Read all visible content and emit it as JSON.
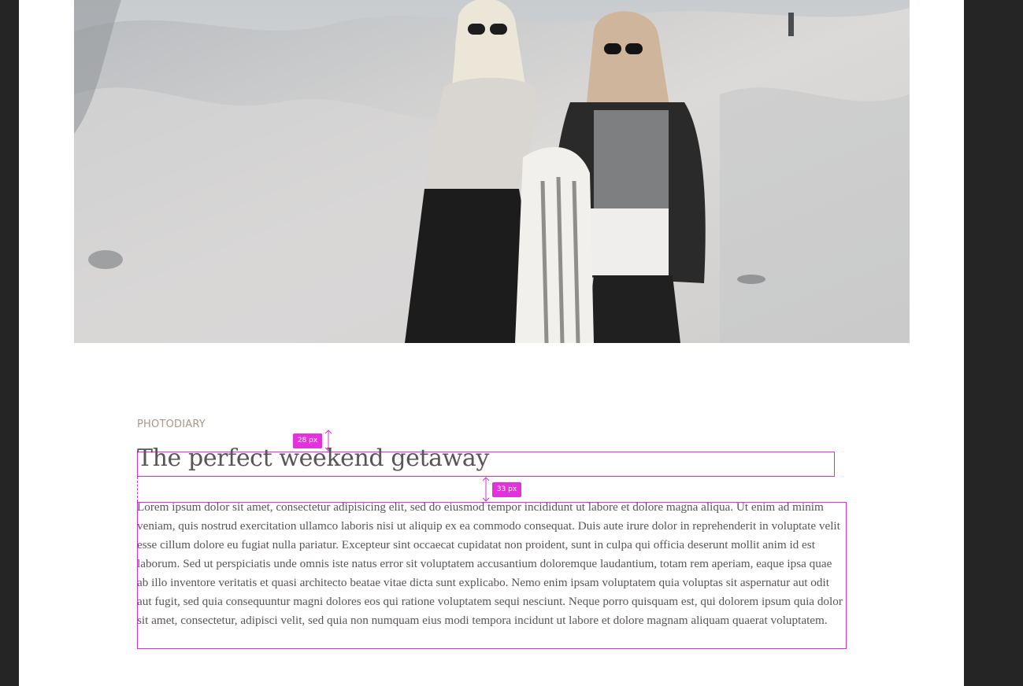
{
  "article": {
    "eyebrow": "PHOTODIARY",
    "title": "The perfect weekend getaway",
    "body": "Lorem ipsum dolor sit amet, consectetur adipisicing elit, sed do eiusmod tempor incididunt ut labore et dolore magna aliqua. Ut enim ad minim veniam, quis nostrud exercitation ullamco laboris nisi ut aliquip ex ea commodo consequat. Duis aute irure dolor in reprehenderit in voluptate velit esse cillum dolore eu fugiat nulla pariatur. Excepteur sint occaecat cupidatat non proident, sunt in culpa qui officia deserunt mollit anim id est laborum. Sed ut perspiciatis unde omnis iste natus error sit voluptatem accusantium doloremque laudantium, totam rem aperiam, eaque ipsa quae ab illo inventore veritatis et quasi architecto beatae vitae dicta sunt explicabo. Nemo enim ipsam voluptatem quia voluptas sit aspernatur aut odit aut fugit, sed quia consequuntur magni dolores eos qui ratione voluptatem sequi nesciunt. Neque porro quisquam est, qui dolorem ipsum quia dolor sit amet, consectetur, adipisci velit, sed quia non numquam eius modi tempora incidunt ut labore et dolore magnam aliquam quaerat voluptatem."
  },
  "measurements": {
    "eyebrow_to_title": "28 px",
    "title_to_body": "33 px"
  },
  "colors": {
    "page_background": "#252525",
    "canvas": "#ffffff",
    "guide_accent": "#d630d6",
    "eyebrow": "#a8968a",
    "text": "#5a5555"
  }
}
